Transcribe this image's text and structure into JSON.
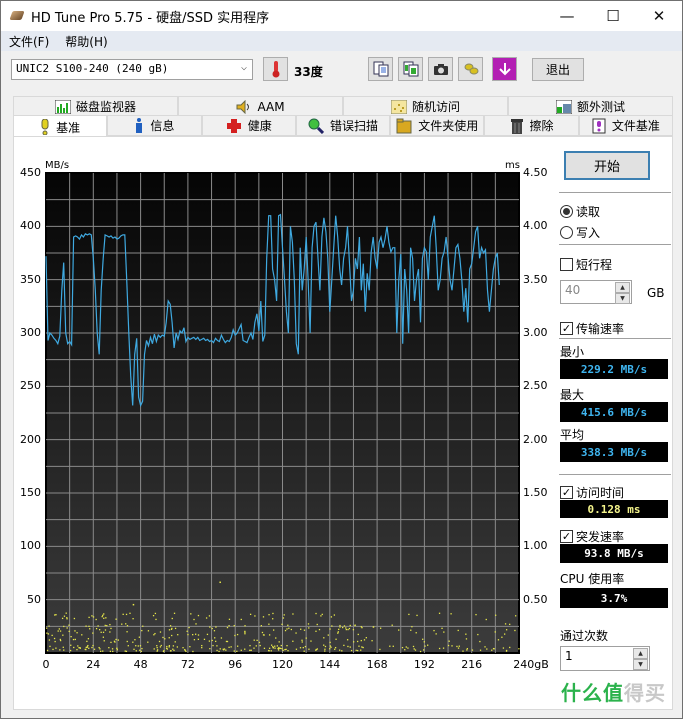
{
  "window": {
    "title": "HD Tune Pro 5.75 - 硬盘/SSD 实用程序",
    "controls": {
      "minimize": "—",
      "maximize": "☐",
      "close": "✕"
    }
  },
  "menu": [
    "文件(F)",
    "帮助(H)"
  ],
  "toolbar": {
    "drive": "UNIC2 S100-240 (240 gB)",
    "temperature": "33度",
    "icons": [
      "copy-text-icon",
      "copy-image-icon",
      "camera-icon",
      "coins-icon",
      "download-icon"
    ],
    "exit_label": "退出"
  },
  "tabs_row1": [
    {
      "label": "磁盘监视器",
      "icon": "monitor-chart-icon"
    },
    {
      "label": "AAM",
      "icon": "speaker-icon"
    },
    {
      "label": "随机访问",
      "icon": "random-dots-icon"
    },
    {
      "label": "额外测试",
      "icon": "extra-test-icon"
    }
  ],
  "tabs_row2": [
    {
      "label": "基准",
      "icon": "exclamation-icon",
      "active": true
    },
    {
      "label": "信息",
      "icon": "info-icon",
      "active": false
    },
    {
      "label": "健康",
      "icon": "red-cross-icon",
      "active": false
    },
    {
      "label": "错误扫描",
      "icon": "magnifier-icon",
      "active": false
    },
    {
      "label": "文件夹使用",
      "icon": "folder-icon",
      "active": false
    },
    {
      "label": "擦除",
      "icon": "trash-icon",
      "active": false
    },
    {
      "label": "文件基准",
      "icon": "file-bench-icon",
      "active": false
    }
  ],
  "side": {
    "start_label": "开始",
    "read_label": "读取",
    "write_label": "写入",
    "mode": "read",
    "short_stroke_label": "短行程",
    "short_stroke_checked": false,
    "short_stroke_value": "40",
    "short_stroke_unit": "GB",
    "transfer_rate_label": "传输速率",
    "transfer_rate_checked": true,
    "min_label": "最小",
    "min_value": "229.2 MB/s",
    "max_label": "最大",
    "max_value": "415.6 MB/s",
    "avg_label": "平均",
    "avg_value": "338.3 MB/s",
    "access_time_label": "访问时间",
    "access_time_checked": true,
    "access_time_value": "0.128 ms",
    "burst_rate_label": "突发速率",
    "burst_rate_checked": true,
    "burst_rate_value": "93.8 MB/s",
    "cpu_label": "CPU 使用率",
    "cpu_value": "3.7%",
    "passes_label": "通过次数",
    "passes_value": "1"
  },
  "colors": {
    "transfer_line": "#3fa9e0",
    "access_dots": "#e8e84a",
    "min_max_avg_text": "#3fb5f0",
    "access_text": "#f5f58c",
    "burst_text": "#ffffff",
    "watermark_green": "#2bb24c"
  },
  "watermark": {
    "part1": "什么值",
    "part2": "得买"
  },
  "chart_data": {
    "type": "line",
    "ylabel": "MB/s",
    "y2label": "ms",
    "xlabel": "gB",
    "ylim": [
      0,
      450
    ],
    "y2lim": [
      0,
      4.5
    ],
    "xlim": [
      0,
      240
    ],
    "yticks": [
      "50",
      "100",
      "150",
      "200",
      "250",
      "300",
      "350",
      "400",
      "450"
    ],
    "y2ticks": [
      "0.50",
      "1.00",
      "1.50",
      "2.00",
      "2.50",
      "3.00",
      "3.50",
      "4.00",
      "4.50"
    ],
    "xticks": [
      "0",
      "24",
      "48",
      "72",
      "96",
      "120",
      "144",
      "168",
      "192",
      "216",
      "240gB"
    ],
    "grid": true,
    "series": [
      {
        "name": "transfer-rate",
        "x": [
          0,
          1,
          2,
          3,
          4,
          5,
          6,
          7,
          8,
          9,
          10,
          11,
          12,
          13,
          14,
          15,
          16,
          17,
          18,
          19,
          20,
          21,
          22,
          23,
          24,
          25,
          26,
          27,
          28,
          29,
          30,
          31,
          32,
          33,
          34,
          35,
          36,
          37,
          38,
          39,
          40,
          41,
          42,
          43,
          44,
          45,
          46,
          47,
          48,
          49,
          50,
          51,
          52,
          53,
          54,
          55,
          56,
          57,
          58,
          59,
          60,
          61,
          62,
          63,
          64,
          65,
          66,
          67,
          68,
          69,
          70,
          71,
          72,
          73,
          74,
          75,
          76,
          77,
          78,
          79,
          80,
          81,
          82,
          83,
          84,
          85,
          86,
          87,
          88,
          89,
          90,
          91,
          92,
          93,
          94,
          95,
          96,
          97,
          98,
          99,
          100,
          101,
          102,
          103,
          104,
          105,
          106,
          107,
          108,
          109,
          110,
          111,
          112,
          113,
          114,
          115,
          116,
          117,
          118,
          119,
          120,
          121,
          122,
          123,
          124,
          125,
          126,
          127,
          128,
          129,
          130,
          131,
          132,
          133,
          134,
          135,
          136,
          137,
          138,
          139,
          140,
          141,
          142,
          143,
          144,
          145,
          146,
          147,
          148,
          149,
          150,
          151,
          152,
          153,
          154,
          155,
          156,
          157,
          158,
          159,
          160,
          161,
          162,
          163,
          164,
          165,
          166,
          167,
          168,
          169,
          170,
          171,
          172,
          173,
          174,
          175,
          176,
          177,
          178,
          179,
          180,
          181,
          182,
          183,
          184,
          185,
          186,
          187,
          188,
          189,
          190,
          191,
          192,
          193,
          194,
          195,
          196,
          197,
          198,
          199,
          200,
          201,
          202,
          203,
          204,
          205,
          206,
          207,
          208,
          209,
          210,
          211,
          212,
          213,
          214,
          215,
          216,
          217,
          218,
          219,
          220,
          221,
          222,
          223,
          224,
          225,
          226,
          227,
          228,
          229,
          230,
          231,
          232,
          233,
          234,
          235,
          236,
          237,
          238,
          239,
          240
        ],
        "values": [
          372,
          293,
          300,
          298,
          295,
          293,
          290,
          297,
          340,
          366,
          300,
          290,
          292,
          289,
          390,
          391,
          390,
          388,
          392,
          390,
          393,
          392,
          393,
          392,
          370,
          340,
          300,
          280,
          340,
          370,
          392,
          391,
          390,
          391,
          389,
          390,
          388,
          389,
          391,
          392,
          392,
          348,
          300,
          260,
          232,
          280,
          295,
          240,
          232,
          236,
          280,
          293,
          288,
          296,
          290,
          299,
          292,
          298,
          296,
          298,
          297,
          310,
          330,
          327,
          310,
          286,
          300,
          294,
          302,
          300,
          305,
          292,
          296,
          294,
          295,
          296,
          294,
          296,
          293,
          294,
          295,
          293,
          294,
          292,
          293,
          291,
          295,
          293,
          292,
          298,
          294,
          291,
          293,
          292,
          296,
          303,
          298,
          300,
          304,
          308,
          293,
          292,
          291,
          296,
          300,
          294,
          310,
          318,
          302,
          330,
          292,
          298,
          370,
          410,
          410,
          360,
          350,
          330,
          410,
          411,
          380,
          350,
          320,
          300,
          400,
          385,
          350,
          290,
          280,
          380,
          340,
          360,
          390,
          350,
          300,
          380,
          400,
          404,
          370,
          340,
          390,
          408,
          395,
          370,
          320,
          350,
          380,
          410,
          390,
          360,
          345,
          370,
          380,
          400,
          365,
          330,
          340,
          370,
          360,
          390,
          340,
          365,
          320,
          356,
          340,
          376,
          390,
          370,
          360,
          385,
          390,
          380,
          388,
          400,
          385,
          376,
          380,
          380,
          300,
          350,
          374,
          290,
          360,
          340,
          300,
          380,
          370,
          330,
          350,
          360,
          310,
          370,
          380,
          376,
          350,
          390,
          400,
          410,
          380,
          340,
          350,
          370,
          376,
          390,
          370,
          350,
          340,
          360,
          380,
          383,
          370,
          350,
          320,
          342,
          310,
          360,
          365,
          380,
          395,
          400,
          370,
          380,
          375,
          378,
          340,
          320,
          340,
          360,
          370,
          375,
          345
        ],
        "color": "#3fa9e0"
      },
      {
        "name": "access-time",
        "summary": "scattered dots mostly between 0.03 and 0.40 ms across 0-240 gB, dense band near 0.05 ms",
        "band_ms": [
          0.03,
          0.4
        ],
        "outliers_ms": [
          0.46,
          0.67
        ],
        "color": "#e8e84a"
      }
    ]
  }
}
